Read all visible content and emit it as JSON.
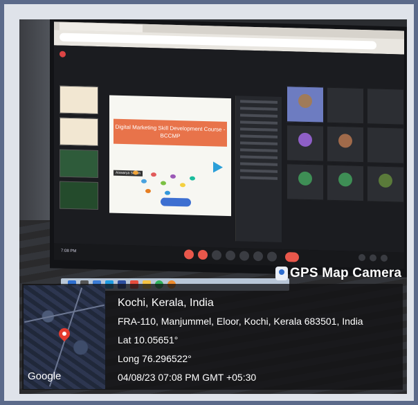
{
  "overlay": {
    "badge": "GPS Map Camera",
    "place": "Kochi, Kerala, India",
    "address": "FRA-110, Manjummel, Eloor, Kochi, Kerala 683501, India",
    "lat": "Lat 10.05651°",
    "long": "Long 76.296522°",
    "datetime": "04/08/23 07:08 PM GMT +05:30",
    "map_logo": "Google"
  },
  "meeting": {
    "slide_title": "Digital Marketing Skill Development Course - BCCMP",
    "presenter": "Aiswarya Sabeh",
    "clock": "7:08 PM"
  },
  "colors": {
    "frame_bg": "#5b6a8a",
    "slide_banner": "#e8734a",
    "pin": "#e53b2e",
    "end_call": "#e8574b"
  }
}
